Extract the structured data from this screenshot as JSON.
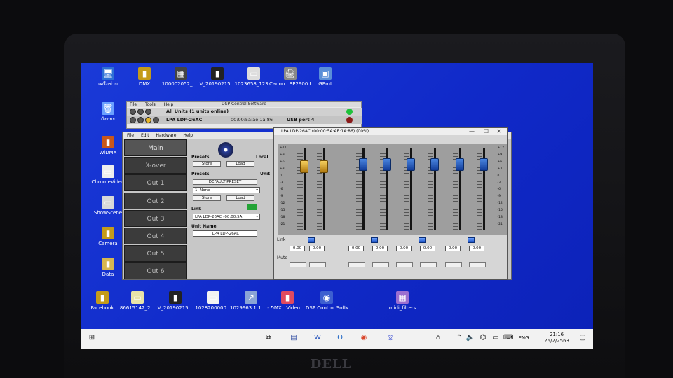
{
  "brand": "DELL",
  "desktop_icons": [
    {
      "label": "เครือข่าย",
      "glyph": "🖥",
      "color": "#2d6fd6"
    },
    {
      "label": "DMX",
      "glyph": "▮",
      "color": "#c49b1a"
    },
    {
      "label": "100002052_L...",
      "glyph": "▦",
      "color": "#444"
    },
    {
      "label": "V_20190215...",
      "glyph": "▮",
      "color": "#222"
    },
    {
      "label": "1023658_123...",
      "glyph": "▭",
      "color": "#ddd"
    },
    {
      "label": "Canon LBP2900 Printer",
      "glyph": "🖨",
      "color": "#888"
    },
    {
      "label": "GEmt",
      "glyph": "▣",
      "color": "#5b8fd8"
    },
    {
      "label": "ถังขยะ",
      "glyph": "🗑",
      "color": "#6aa0ff"
    },
    {
      "label": "WiDMX",
      "glyph": "▮",
      "color": "#c9571a"
    },
    {
      "label": "ChromeVideo",
      "glyph": "▭",
      "color": "#eee"
    },
    {
      "label": "ShowScene",
      "glyph": "▭",
      "color": "#d8d8d8"
    },
    {
      "label": "Camera",
      "glyph": "▮",
      "color": "#c49b1a"
    },
    {
      "label": "Data",
      "glyph": "▮",
      "color": "#d6b650"
    },
    {
      "label": "Facebook",
      "glyph": "▮",
      "color": "#c49b1a"
    },
    {
      "label": "86615142_2...",
      "glyph": "▭",
      "color": "#e9e3a8"
    },
    {
      "label": "V_20190215...",
      "glyph": "▮",
      "color": "#222"
    },
    {
      "label": "1028200000...",
      "glyph": "▭",
      "color": "#f2f2f2"
    },
    {
      "label": "1029963 1 1... - Shortcut",
      "glyph": "↗",
      "color": "#8aa4d6"
    },
    {
      "label": "DMX...Video...",
      "glyph": "▮",
      "color": "#e04a60"
    },
    {
      "label": "DSP Control Software",
      "glyph": "◉",
      "color": "#3d5fd0"
    },
    {
      "label": "midi_filters",
      "glyph": "▦",
      "color": "#9b6fd0"
    }
  ],
  "win1": {
    "title": "DSP Control Software",
    "menu": [
      "File",
      "Tools",
      "Help"
    ],
    "row_all": {
      "name": "All Units (1 units online)"
    },
    "row_unit": {
      "name": "LPA LDP-26AC",
      "mac": "00:00:5a:ae:1a:86",
      "port": "USB port 4"
    }
  },
  "win2": {
    "menu": [
      "File",
      "Edit",
      "Hardware",
      "Help"
    ],
    "nav": [
      "Main",
      "X-over",
      "Out 1",
      "Out 2",
      "Out 3",
      "Out 4",
      "Out 5",
      "Out 6"
    ],
    "presets_local": "Presets",
    "local_label": "Local",
    "store": "Store",
    "load": "Load",
    "presets_unit": "Presets",
    "unit_label": "Unit",
    "default_preset": "DEFAULT PRESET",
    "preset_select": "1: None",
    "link_label": "Link",
    "link_select": "LPA LDP-26AC (00:00:5A",
    "unit_name_label": "Unit Name",
    "unit_name_value": "LPA LDP-26AC"
  },
  "win3": {
    "title": "LPA LDP-26AC (00:00:5A:AE:1A:86) (00%)",
    "scale": [
      "+12",
      "+9",
      "+6",
      "+3",
      "0",
      "-3",
      "-6",
      "-9",
      "-12",
      "-15",
      "-18",
      "-21"
    ],
    "channels": [
      {
        "level": 0.18,
        "color": "gold"
      },
      {
        "level": 0.18,
        "color": "gold"
      },
      {
        "level": 0.15,
        "color": "blue"
      },
      {
        "level": 0.15,
        "color": "blue"
      },
      {
        "level": 0.15,
        "color": "blue"
      },
      {
        "level": 0.15,
        "color": "blue"
      },
      {
        "level": 0.15,
        "color": "blue"
      },
      {
        "level": 0.15,
        "color": "blue"
      }
    ],
    "link_label": "Link",
    "mute_label": "Mute",
    "values": [
      "0.00",
      "0.00",
      "0.00",
      "0.00",
      "0.00",
      "0.00",
      "0.00",
      "0.00"
    ]
  },
  "taskbar": {
    "time": "21:16",
    "date": "26/2/2563",
    "lang": "ENG"
  }
}
